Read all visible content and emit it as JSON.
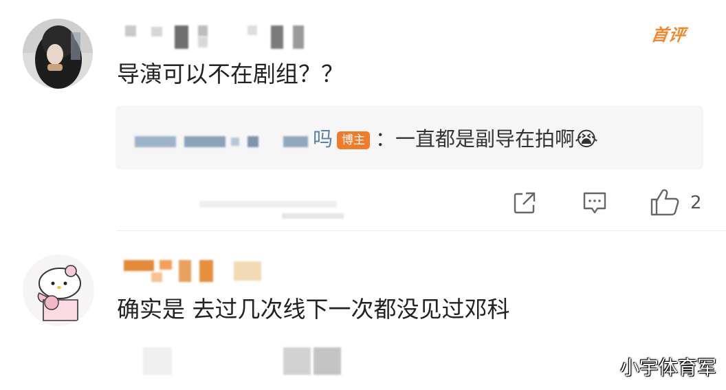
{
  "comments": [
    {
      "text": "导演可以不在剧组？？",
      "badge": "首评",
      "reply": {
        "author_suffix": "吗",
        "author_badge": "博主",
        "text": "：一直都是副导在拍啊😭"
      },
      "like_count": "2"
    },
    {
      "text": "确实是 去过几次线下一次都没见过邓科"
    }
  ],
  "watermark": "小宇体育军",
  "icons": [
    "share-icon",
    "comment-icon",
    "like-icon"
  ],
  "colors": {
    "accent": "#f27b2a",
    "first_badge": "#f0862e",
    "text": "#222222"
  }
}
